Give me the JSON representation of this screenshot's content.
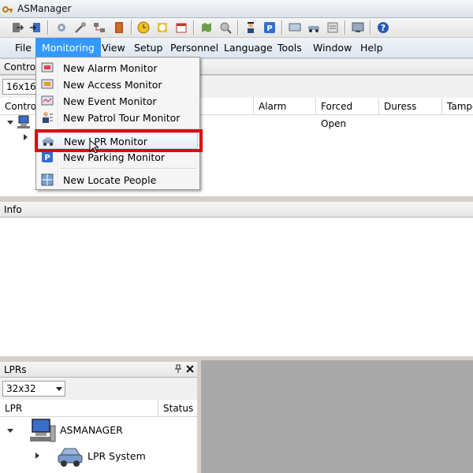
{
  "window": {
    "title": "ASManager"
  },
  "menubar": {
    "items": [
      {
        "label": "File"
      },
      {
        "label": "Monitoring"
      },
      {
        "label": "View"
      },
      {
        "label": "Setup"
      },
      {
        "label": "Personnel"
      },
      {
        "label": "Language"
      },
      {
        "label": "Tools"
      },
      {
        "label": "Window"
      },
      {
        "label": "Help"
      }
    ]
  },
  "monitoring_menu": {
    "items": [
      {
        "label": "New Alarm Monitor",
        "icon": "alarm-monitor-icon"
      },
      {
        "label": "New Access Monitor",
        "icon": "access-monitor-icon"
      },
      {
        "label": "New Event Monitor",
        "icon": "event-monitor-icon"
      },
      {
        "label": "New Patrol Tour Monitor",
        "icon": "patrol-tour-icon"
      },
      {
        "label": "New LPR Monitor",
        "icon": "lpr-car-icon"
      },
      {
        "label": "New Parking Monitor",
        "icon": "parking-icon"
      },
      {
        "label": "New Locate People",
        "icon": "locate-people-icon"
      }
    ],
    "highlight_color": "#e8000f"
  },
  "control_panel": {
    "header": "Control",
    "icon_size": "16x16",
    "columns": {
      "name": "Control",
      "alarm": "Alarm",
      "forced_open": "Forced Open",
      "duress": "Duress",
      "tamper": "Tamper"
    }
  },
  "info_panel": {
    "header": "Info"
  },
  "lpr_panel": {
    "header": "LPRs",
    "icon_size": "32x32",
    "columns": {
      "lpr": "LPR",
      "status": "Status"
    },
    "tree": {
      "root": "ASMANAGER",
      "child": "LPR System"
    }
  },
  "colors": {
    "menu_active": "#3399ff"
  }
}
